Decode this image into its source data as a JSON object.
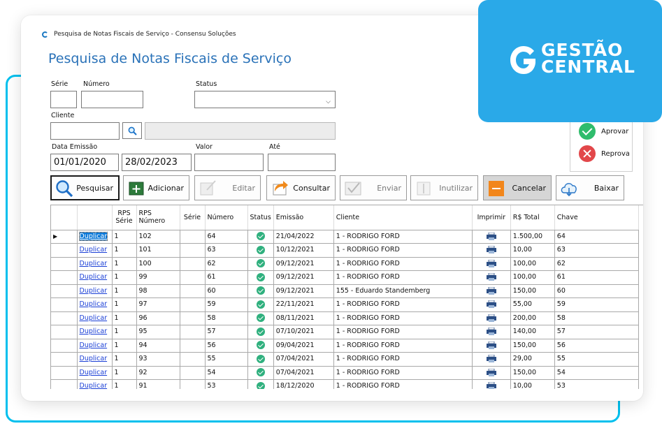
{
  "window": {
    "title": "Pesquisa de Notas Fiscais de Serviço - Consensu Soluções"
  },
  "page_title": "Pesquisa de Notas Fiscais de Serviço",
  "filters": {
    "serie_label": "Série",
    "numero_label": "Número",
    "status_label": "Status",
    "cliente_label": "Cliente",
    "data_emissao_label": "Data Emissão",
    "data_inicio": "01/01/2020",
    "data_fim": "28/02/2023",
    "valor_label": "Valor",
    "ate_label": "Até"
  },
  "toolbar": {
    "pesquisar": "Pesquisar",
    "adicionar": "Adicionar",
    "editar": "Editar",
    "consultar": "Consultar",
    "enviar": "Enviar",
    "inutilizar": "Inutilizar",
    "cancelar": "Cancelar",
    "baixar": "Baixar"
  },
  "side_panel": {
    "aprovar": "Aprovar",
    "reprovar": "Reprovar"
  },
  "brand": {
    "line1": "GESTÃO",
    "line2": "CENTRAL",
    "color": "#2aa9e8"
  },
  "grid": {
    "headers": {
      "rps_serie": "RPS Série",
      "rps_numero": "RPS Número",
      "serie": "Série",
      "numero": "Número",
      "status": "Status",
      "emissao": "Emissão",
      "cliente": "Cliente",
      "imprimir": "Imprimir",
      "total": "R$ Total",
      "chave": "Chave"
    },
    "link_label": "Duplicar",
    "rows": [
      {
        "rps_serie": "1",
        "rps_numero": "102",
        "numero": "64",
        "emissao": "21/04/2022",
        "cliente": "1 - RODRIGO FORD",
        "total": "1.500,00",
        "chave": "64"
      },
      {
        "rps_serie": "1",
        "rps_numero": "101",
        "numero": "63",
        "emissao": "10/12/2021",
        "cliente": "1 - RODRIGO FORD",
        "total": "10,00",
        "chave": "63"
      },
      {
        "rps_serie": "1",
        "rps_numero": "100",
        "numero": "62",
        "emissao": "09/12/2021",
        "cliente": "1 - RODRIGO FORD",
        "total": "100,00",
        "chave": "62"
      },
      {
        "rps_serie": "1",
        "rps_numero": "99",
        "numero": "61",
        "emissao": "09/12/2021",
        "cliente": "1 - RODRIGO FORD",
        "total": "100,00",
        "chave": "61"
      },
      {
        "rps_serie": "1",
        "rps_numero": "98",
        "numero": "60",
        "emissao": "09/12/2021",
        "cliente": "155 - Eduardo Standemberg",
        "total": "150,00",
        "chave": "60"
      },
      {
        "rps_serie": "1",
        "rps_numero": "97",
        "numero": "59",
        "emissao": "22/11/2021",
        "cliente": "1 - RODRIGO FORD",
        "total": "55,00",
        "chave": "59"
      },
      {
        "rps_serie": "1",
        "rps_numero": "96",
        "numero": "58",
        "emissao": "08/11/2021",
        "cliente": "1 - RODRIGO FORD",
        "total": "200,00",
        "chave": "58"
      },
      {
        "rps_serie": "1",
        "rps_numero": "95",
        "numero": "57",
        "emissao": "07/10/2021",
        "cliente": "1 - RODRIGO FORD",
        "total": "140,00",
        "chave": "57"
      },
      {
        "rps_serie": "1",
        "rps_numero": "94",
        "numero": "56",
        "emissao": "09/04/2021",
        "cliente": "1 - RODRIGO FORD",
        "total": "150,00",
        "chave": "56"
      },
      {
        "rps_serie": "1",
        "rps_numero": "93",
        "numero": "55",
        "emissao": "07/04/2021",
        "cliente": "1 - RODRIGO FORD",
        "total": "29,00",
        "chave": "55"
      },
      {
        "rps_serie": "1",
        "rps_numero": "92",
        "numero": "54",
        "emissao": "07/04/2021",
        "cliente": "1 - RODRIGO FORD",
        "total": "150,00",
        "chave": "54"
      },
      {
        "rps_serie": "1",
        "rps_numero": "91",
        "numero": "53",
        "emissao": "18/12/2020",
        "cliente": "1 - RODRIGO FORD",
        "total": "10,00",
        "chave": "53"
      }
    ]
  }
}
